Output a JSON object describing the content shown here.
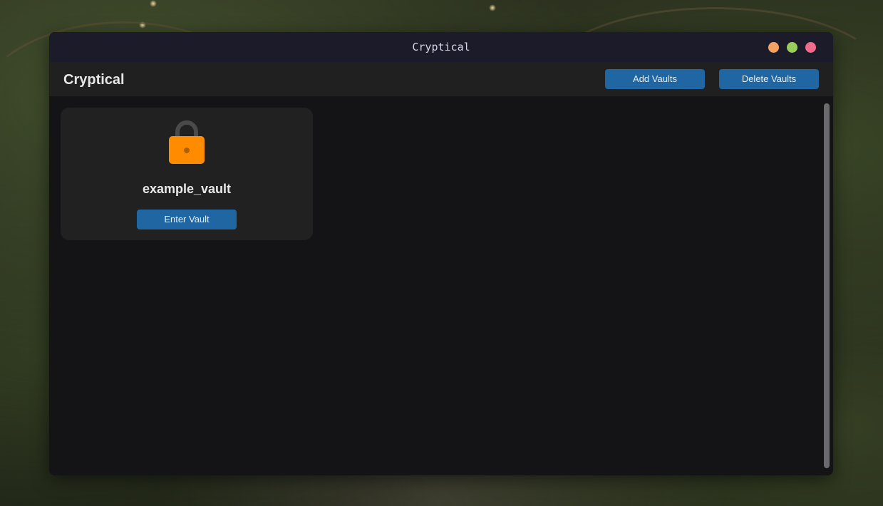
{
  "window": {
    "title": "Cryptical",
    "controls": [
      {
        "name": "minimize",
        "color": "#f4a261"
      },
      {
        "name": "maximize",
        "color": "#9acd5a"
      },
      {
        "name": "close",
        "color": "#f06c8a"
      }
    ]
  },
  "header": {
    "title": "Cryptical",
    "add_label": "Add Vaults",
    "delete_label": "Delete Vaults"
  },
  "vaults": [
    {
      "name": "example_vault",
      "icon": "lock-icon",
      "enter_label": "Enter Vault"
    }
  ],
  "colors": {
    "accent": "#1f66a3",
    "lock_body": "#ff8c00",
    "lock_shackle": "#4a4a4a",
    "card_bg": "#212121",
    "content_bg": "#141315"
  }
}
